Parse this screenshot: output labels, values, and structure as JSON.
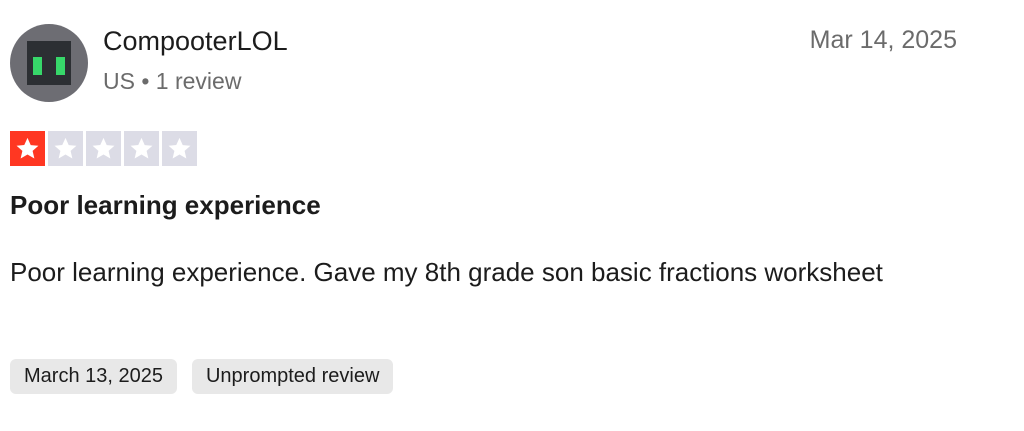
{
  "reviewer": {
    "name": "CompooterLOL",
    "country": "US",
    "separator": "•",
    "review_count": "1 review",
    "avatar_icon": "robot-face-icon"
  },
  "review": {
    "date": "Mar 14, 2025",
    "rating": 1,
    "max_rating": 5,
    "title": "Poor learning experience",
    "body": "Poor learning experience. Gave my 8th grade son basic fractions worksheet"
  },
  "tags": [
    {
      "label": "March 13, 2025"
    },
    {
      "label": "Unprompted review"
    }
  ],
  "colors": {
    "star_filled": "#ff3722",
    "star_empty": "#dcdce6",
    "tag_bg": "#e8e8e8",
    "avatar_bg": "#6d6d73",
    "avatar_eye": "#37d86a"
  }
}
